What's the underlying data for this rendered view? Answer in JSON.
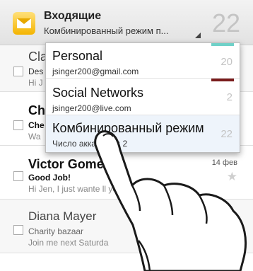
{
  "header": {
    "title": "Входящие",
    "subtitle": "Комбинированный режим п...",
    "unread_count": "22",
    "icon": "mail-envelope-icon",
    "accent_color": "#f4b400"
  },
  "messages": [
    {
      "sender": "Cla",
      "subject": "Des",
      "snippet": "Hi J",
      "unread": false
    },
    {
      "sender": "Ch",
      "subject": "Che",
      "snippet": "Wa",
      "unread": true
    },
    {
      "sender": "Victor Gome",
      "subject": "Good Job!",
      "snippet": "Hi Jen, I just wante      ll you that you...",
      "date": "14 фев",
      "unread": true
    },
    {
      "sender": "Diana Mayer",
      "subject": "Charity bazaar",
      "snippet": "Join me next Saturda",
      "unread": false
    }
  ],
  "account_menu": {
    "accounts": [
      {
        "name": "Personal",
        "email": "jsinger200@gmail.com",
        "count": "20",
        "color": "#6fd1c8"
      },
      {
        "name": "Social Networks",
        "email": "jsinger200@live.com",
        "count": "2",
        "color": "#7a1c1c"
      },
      {
        "name": "Комбинированный режим",
        "email": "Число аккаунтов: 2",
        "count": "22",
        "color": ""
      }
    ]
  },
  "overlay": {
    "icon": "pointing-hand-icon"
  }
}
